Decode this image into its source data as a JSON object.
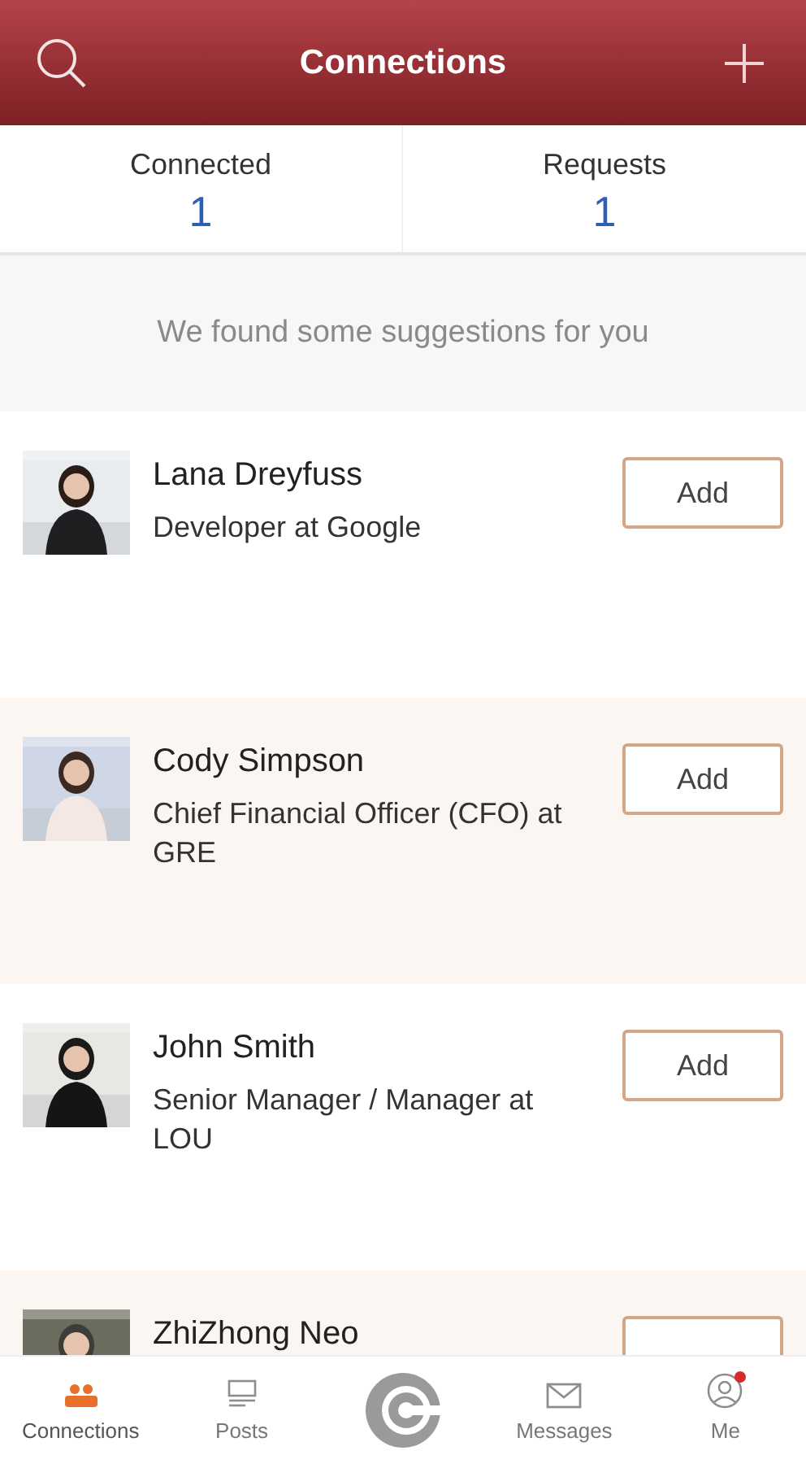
{
  "header": {
    "title": "Connections"
  },
  "stats": [
    {
      "label": "Connected",
      "value": "1"
    },
    {
      "label": "Requests",
      "value": "1"
    }
  ],
  "suggestion_note": "We found some suggestions for you",
  "suggestions": [
    {
      "name": "Lana Dreyfuss",
      "title": "Developer at Google",
      "button": "Add"
    },
    {
      "name": "Cody Simpson",
      "title": "Chief Financial Officer (CFO) at GRE",
      "button": "Add"
    },
    {
      "name": "John Smith",
      "title": "Senior Manager / Manager at LOU",
      "button": "Add"
    },
    {
      "name": "ZhiZhong Neo"
    }
  ],
  "bottom_nav": [
    {
      "kind": "connections",
      "label": "Connections",
      "selected": true,
      "notification": false
    },
    {
      "kind": "posts",
      "label": "Posts",
      "selected": false,
      "notification": false
    },
    {
      "kind": "logo"
    },
    {
      "kind": "messages",
      "label": "Messages",
      "selected": false,
      "notification": false
    },
    {
      "kind": "me",
      "label": "Me",
      "selected": false,
      "notification": true
    }
  ]
}
